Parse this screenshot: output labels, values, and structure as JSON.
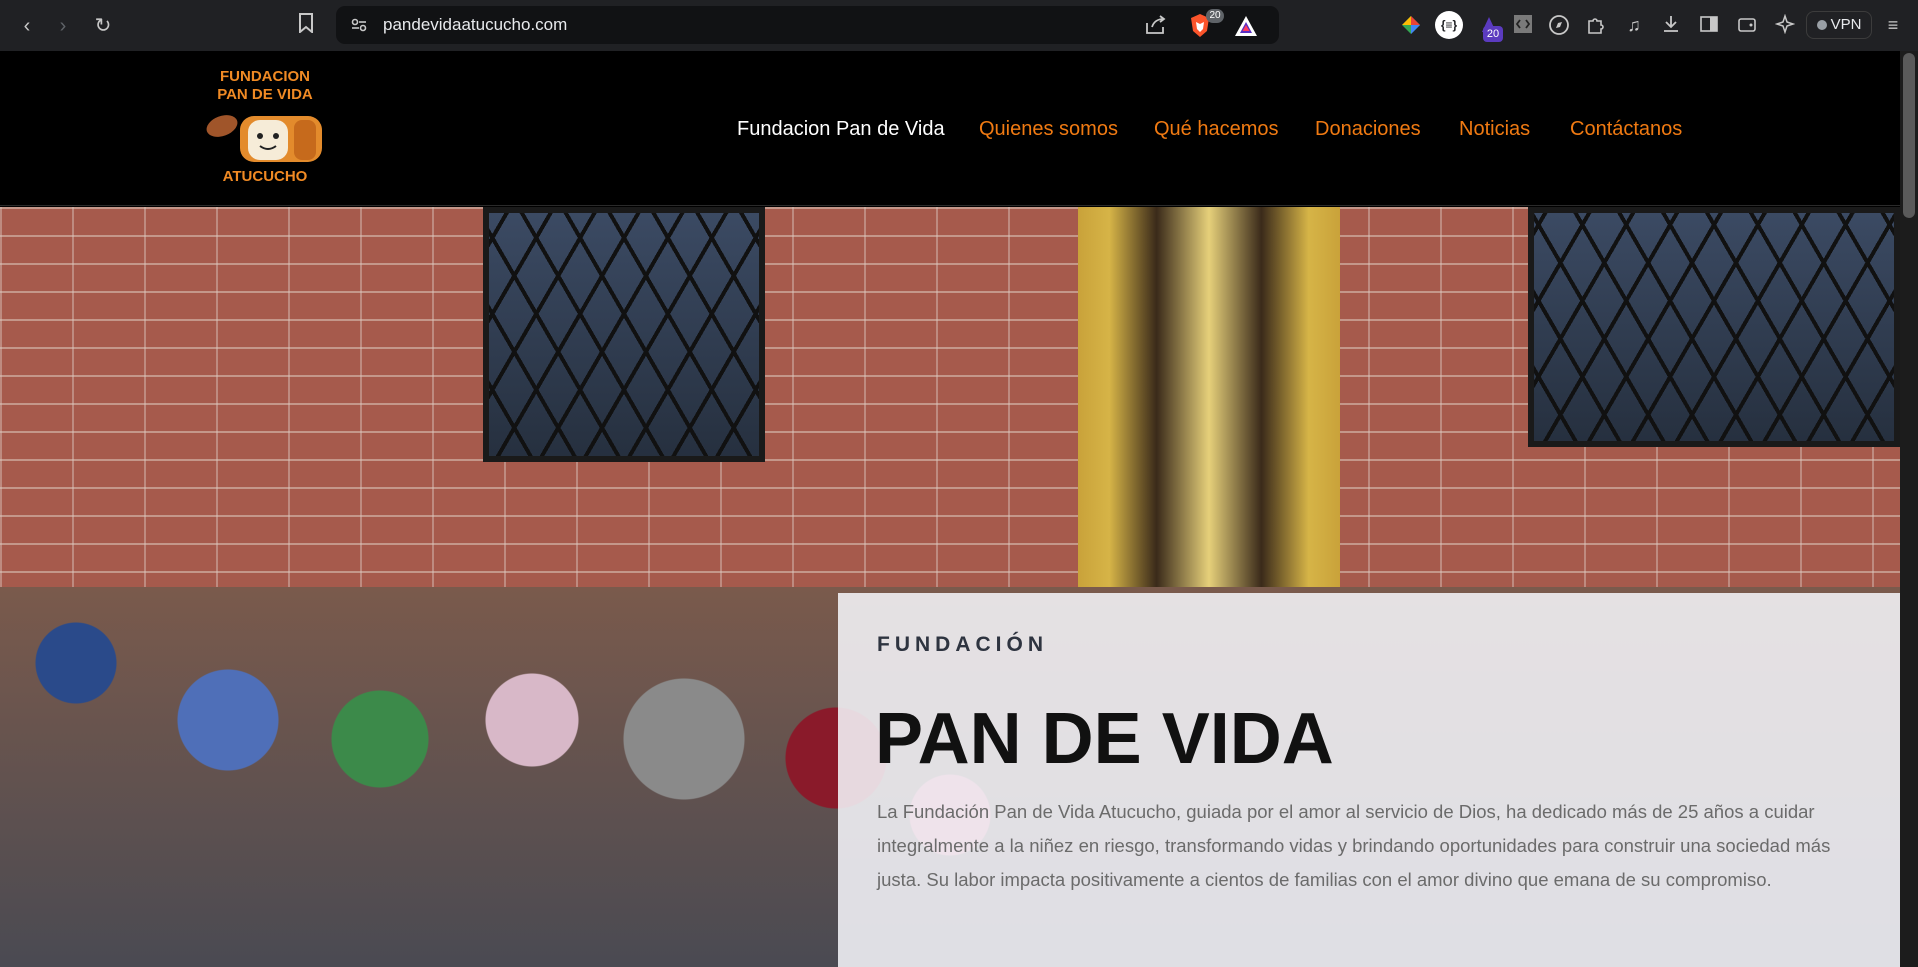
{
  "browser": {
    "url": "pandevidaatucucho.com",
    "brave_badge": "20",
    "extension_badge": "20",
    "vpn_label": "VPN",
    "json_ext_label": "{≡}"
  },
  "site": {
    "logo": {
      "top_line1": "FUNDACION",
      "top_line2": "PAN DE VIDA",
      "bottom": "ATUCUCHO"
    },
    "nav": [
      {
        "label": "Fundacion Pan de Vida"
      },
      {
        "label": "Quienes somos"
      },
      {
        "label": "Qué hacemos"
      },
      {
        "label": "Donaciones"
      },
      {
        "label": "Noticias"
      },
      {
        "label": "Contáctanos"
      }
    ],
    "colors": {
      "accent": "#f07a12",
      "header_bg": "#000000"
    }
  },
  "hero": {
    "kicker": "FUNDACIÓN",
    "title": "PAN DE VIDA",
    "body": "La Fundación Pan de Vida Atucucho, guiada por el amor al servicio de Dios, ha dedicado más de 25 años a cuidar integralmente a la niñez en riesgo, transformando vidas y brindando oportunidades para construir una sociedad más justa. Su labor impacta positivamente a cientos de familias con el amor divino que emana de su compromiso."
  }
}
